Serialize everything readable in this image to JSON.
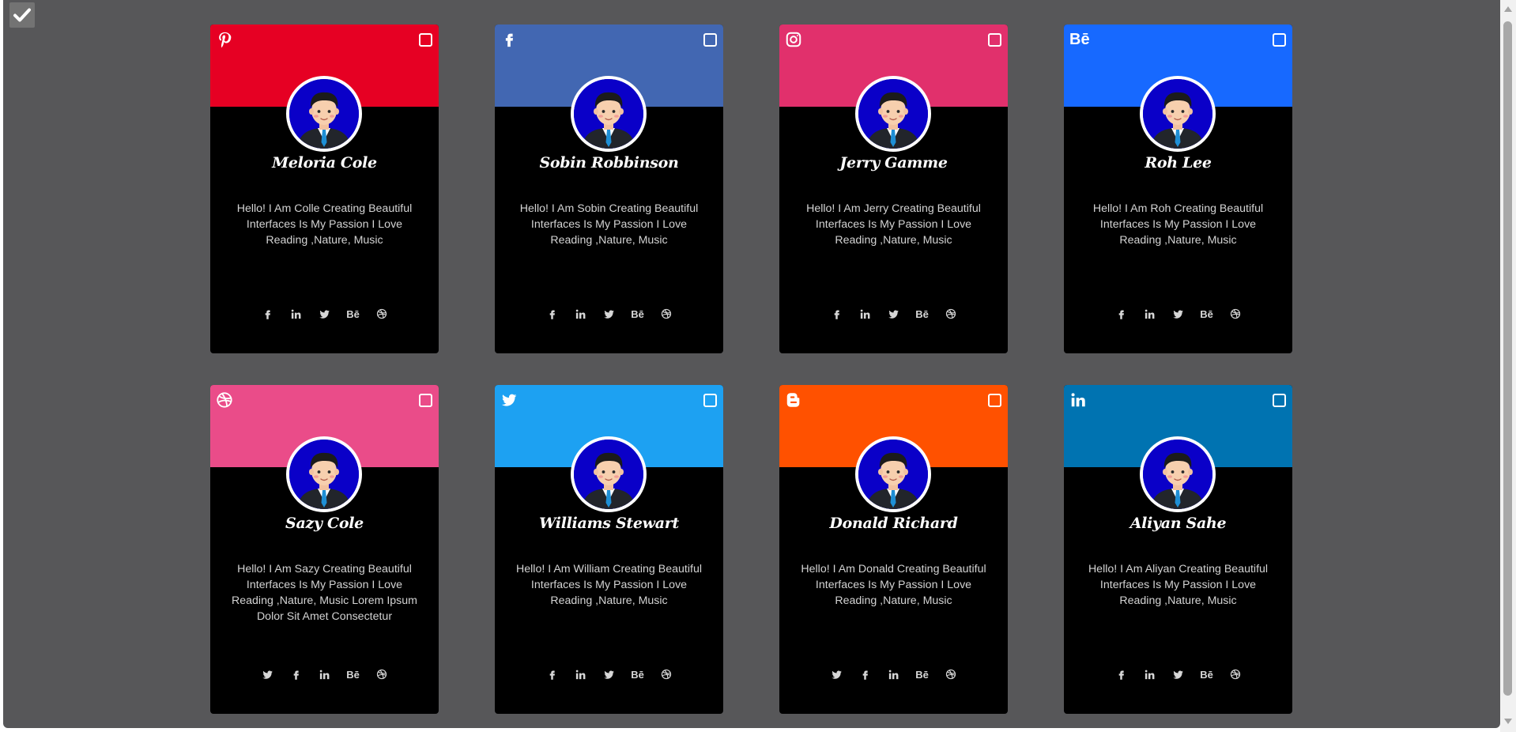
{
  "cards": [
    {
      "name": "Meloria Cole",
      "bio": "Hello! I Am Colle Creating Beautiful Interfaces Is My Passion I Love Reading ,Nature, Music",
      "brand_icon": "pinterest-icon",
      "header_color": "#e60023",
      "socials": [
        "facebook",
        "linkedin",
        "twitter",
        "behance",
        "dribbble"
      ],
      "selected": false,
      "be_label": "Bē"
    },
    {
      "name": "Sobin Robbinson",
      "bio": "Hello! I Am Sobin Creating Beautiful Interfaces Is My Passion I Love Reading ,Nature, Music",
      "brand_icon": "facebook-icon",
      "header_color": "#4267b2",
      "socials": [
        "facebook",
        "linkedin",
        "twitter",
        "behance",
        "dribbble"
      ],
      "selected": false,
      "be_label": "Bē"
    },
    {
      "name": "Jerry Gamme",
      "bio": "Hello! I Am Jerry Creating Beautiful Interfaces Is My Passion I Love Reading ,Nature, Music",
      "brand_icon": "instagram-icon",
      "header_color": "#e1306c",
      "socials": [
        "facebook",
        "linkedin",
        "twitter",
        "behance",
        "dribbble"
      ],
      "selected": false,
      "be_label": "Bē"
    },
    {
      "name": "Roh Lee",
      "bio": "Hello! I Am Roh Creating Beautiful Interfaces Is My Passion I Love Reading ,Nature, Music",
      "brand_icon": "behance-icon",
      "header_color": "#1769ff",
      "socials": [
        "facebook",
        "linkedin",
        "twitter",
        "behance",
        "dribbble"
      ],
      "selected": false,
      "be_label": "Bē",
      "brand_label": "Bē"
    },
    {
      "name": "Sazy Cole",
      "bio": "Hello! I Am Sazy Creating Beautiful Interfaces Is My Passion I Love Reading ,Nature, Music Lorem Ipsum Dolor Sit Amet Consectetur",
      "brand_icon": "dribbble-icon",
      "header_color": "#ea4c89",
      "socials": [
        "twitter",
        "facebook",
        "linkedin",
        "behance",
        "dribbble"
      ],
      "selected": false,
      "be_label": "Bē"
    },
    {
      "name": "Williams Stewart",
      "bio": "Hello! I Am William Creating Beautiful Interfaces Is My Passion I Love Reading ,Nature, Music",
      "brand_icon": "twitter-icon",
      "header_color": "#1da1f2",
      "socials": [
        "facebook",
        "linkedin",
        "twitter",
        "behance",
        "dribbble"
      ],
      "selected": false,
      "be_label": "Bē"
    },
    {
      "name": "Donald Richard",
      "bio": "Hello! I Am Donald Creating Beautiful Interfaces Is My Passion I Love Reading ,Nature, Music",
      "brand_icon": "blogger-icon",
      "header_color": "#ff5100",
      "socials": [
        "twitter",
        "facebook",
        "linkedin",
        "behance",
        "dribbble"
      ],
      "selected": false,
      "be_label": "Bē"
    },
    {
      "name": "Aliyan Sahe",
      "bio": "Hello! I Am Aliyan Creating Beautiful Interfaces Is My Passion I Love Reading ,Nature, Music",
      "brand_icon": "linkedin-icon",
      "header_color": "#0073b1",
      "socials": [
        "facebook",
        "linkedin",
        "twitter",
        "behance",
        "dribbble"
      ],
      "selected": false,
      "be_label": "Bē"
    }
  ],
  "master_checkbox": {
    "checked": true,
    "icon": "check-icon"
  },
  "colors": {
    "background": "#575759",
    "card": "#000000",
    "bio_text": "#d3d3d3"
  }
}
